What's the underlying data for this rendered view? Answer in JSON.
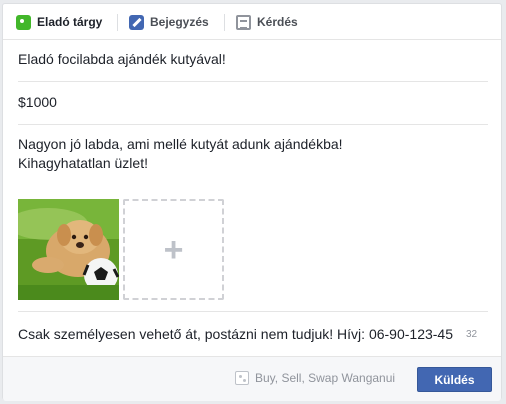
{
  "tabs": [
    {
      "label": "Eladó tárgy",
      "icon": "price-tag-icon",
      "active": true
    },
    {
      "label": "Bejegyzés",
      "icon": "pencil-icon",
      "active": false
    },
    {
      "label": "Kérdés",
      "icon": "document-icon",
      "active": false
    }
  ],
  "form": {
    "title": "Eladó focilabda ajándék kutyával!",
    "price": "$1000",
    "description_line1": "Nagyon jó labda, ami mellé kutyát adunk ajándékba!",
    "description_line2": "Kihagyhatatlan üzlet!",
    "location": "Csak személyesen vehető át, postázni nem tudjuk! Hívj: 06-90-123-45",
    "char_counter": "32",
    "photo_alt": "puppy-with-soccer-ball",
    "add_photo_symbol": "+"
  },
  "footer": {
    "group_name": "Buy, Sell, Swap Wanganui",
    "group_icon": "dice-icon",
    "send_label": "Küldés"
  },
  "colors": {
    "accent": "#4267b2",
    "active_tag": "#42b72a",
    "muted_text": "#90949c"
  }
}
